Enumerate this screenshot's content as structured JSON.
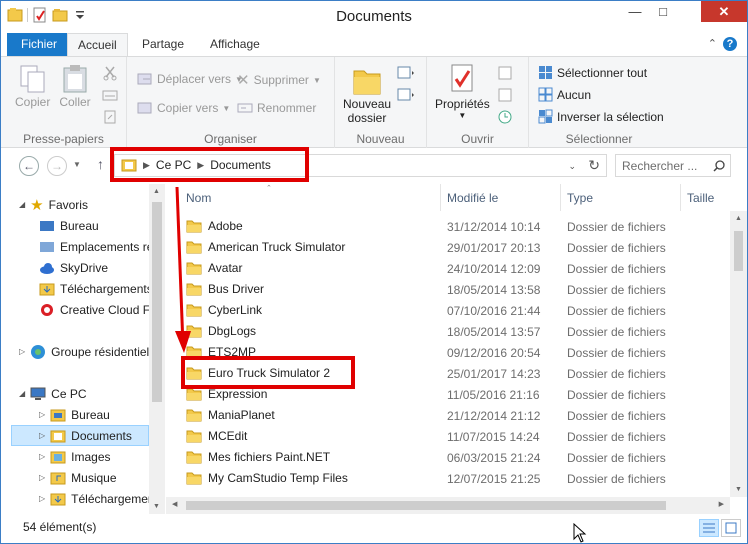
{
  "window": {
    "title": "Documents"
  },
  "tabs": {
    "file": "Fichier",
    "home": "Accueil",
    "share": "Partage",
    "view": "Affichage"
  },
  "ribbon": {
    "clipboard": {
      "label": "Presse-papiers",
      "copy": "Copier",
      "paste": "Coller"
    },
    "organize": {
      "label": "Organiser",
      "move": "Déplacer vers",
      "copy_to": "Copier vers",
      "delete": "Supprimer",
      "rename": "Renommer"
    },
    "new": {
      "label": "Nouveau",
      "new_folder_1": "Nouveau",
      "new_folder_2": "dossier"
    },
    "open": {
      "label": "Ouvrir",
      "properties": "Propriétés"
    },
    "select": {
      "label": "Sélectionner",
      "all": "Sélectionner tout",
      "none": "Aucun",
      "invert": "Inverser la sélection"
    }
  },
  "address": {
    "crumbs": [
      "Ce PC",
      "Documents"
    ],
    "search_placeholder": "Rechercher ..."
  },
  "nav": {
    "favorites": "Favoris",
    "fav_items": [
      "Bureau",
      "Emplacements ré",
      "SkyDrive",
      "Téléchargements",
      "Creative Cloud Fi"
    ],
    "homegroup": "Groupe résidentiel",
    "this_pc": "Ce PC",
    "pc_items": [
      "Bureau",
      "Documents",
      "Images",
      "Musique",
      "Téléchargements"
    ]
  },
  "columns": {
    "name": "Nom",
    "modified": "Modifié le",
    "type": "Type",
    "size": "Taille"
  },
  "files": [
    {
      "name": "Adobe",
      "date": "31/12/2014 10:14",
      "type": "Dossier de fichiers"
    },
    {
      "name": "American Truck Simulator",
      "date": "29/01/2017 20:13",
      "type": "Dossier de fichiers"
    },
    {
      "name": "Avatar",
      "date": "24/10/2014 12:09",
      "type": "Dossier de fichiers"
    },
    {
      "name": "Bus Driver",
      "date": "18/05/2014 13:58",
      "type": "Dossier de fichiers"
    },
    {
      "name": "CyberLink",
      "date": "07/10/2016 21:44",
      "type": "Dossier de fichiers"
    },
    {
      "name": "DbgLogs",
      "date": "18/05/2014 13:57",
      "type": "Dossier de fichiers"
    },
    {
      "name": "ETS2MP",
      "date": "09/12/2016 20:54",
      "type": "Dossier de fichiers"
    },
    {
      "name": "Euro Truck Simulator 2",
      "date": "25/01/2017 14:23",
      "type": "Dossier de fichiers"
    },
    {
      "name": "Expression",
      "date": "11/05/2016 21:16",
      "type": "Dossier de fichiers"
    },
    {
      "name": "ManiaPlanet",
      "date": "21/12/2014 21:12",
      "type": "Dossier de fichiers"
    },
    {
      "name": "MCEdit",
      "date": "11/07/2015 14:24",
      "type": "Dossier de fichiers"
    },
    {
      "name": "Mes fichiers Paint.NET",
      "date": "06/03/2015 21:24",
      "type": "Dossier de fichiers"
    },
    {
      "name": "My CamStudio Temp Files",
      "date": "12/07/2015 21:25",
      "type": "Dossier de fichiers"
    }
  ],
  "status": {
    "count": "54 élément(s)"
  },
  "colors": {
    "accent": "#1979ca",
    "highlight": "#e00000",
    "selection": "#cce8ff"
  }
}
